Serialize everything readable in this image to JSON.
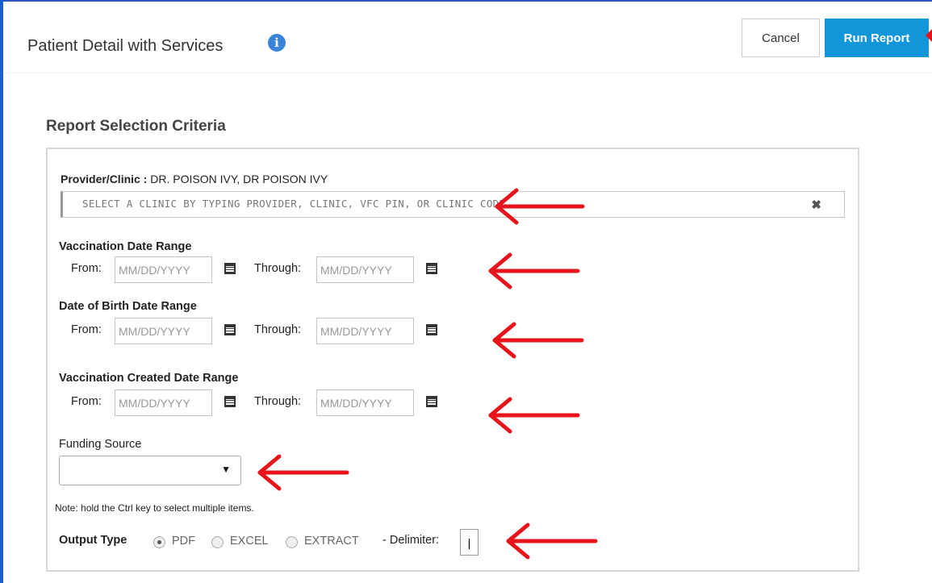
{
  "header": {
    "title": "Patient Detail with Services",
    "cancel_label": "Cancel",
    "run_label": "Run Report"
  },
  "section": {
    "title": "Report Selection Criteria"
  },
  "provider": {
    "label": "Provider/Clinic :",
    "value": "DR. POISON IVY, DR POISON IVY",
    "placeholder": "SELECT A CLINIC BY TYPING PROVIDER, CLINIC, VFC PIN, OR CLINIC CODE",
    "clear_glyph": "✖"
  },
  "date_ranges": [
    {
      "title": "Vaccination Date Range",
      "from_label": "From:",
      "through_label": "Through:",
      "placeholder": "MM/DD/YYYY"
    },
    {
      "title": "Date of Birth Date Range",
      "from_label": "From:",
      "through_label": "Through:",
      "placeholder": "MM/DD/YYYY"
    },
    {
      "title": "Vaccination Created Date Range",
      "from_label": "From:",
      "through_label": "Through:",
      "placeholder": "MM/DD/YYYY"
    }
  ],
  "funding": {
    "label": "Funding Source",
    "selected": "",
    "note": "Note: hold the Ctrl key to select multiple items."
  },
  "output": {
    "label": "Output Type",
    "options": [
      "PDF",
      "EXCEL",
      "EXTRACT"
    ],
    "selected": "PDF",
    "delimiter_label": "- Delimiter:",
    "delimiter_value": "|"
  },
  "icons": {
    "info": "info-icon",
    "calendar": "calendar-icon",
    "dropdown": "chevron-down-icon",
    "annotation": "red-arrow"
  },
  "colors": {
    "primary_button": "#1196d9",
    "info_icon": "#3b83d9",
    "annotation_arrow": "#e8141c",
    "frame": "#1c5fd1"
  }
}
